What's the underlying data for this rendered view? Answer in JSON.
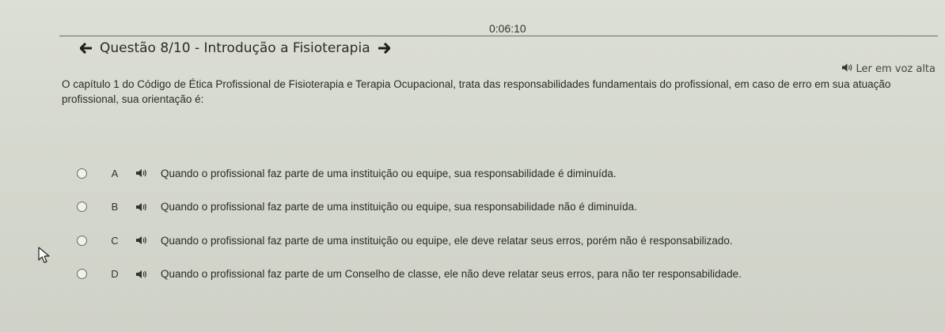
{
  "timer": "0:06:10",
  "header": {
    "title": "Questão 8/10 - Introdução a Fisioterapia",
    "prev_icon": "arrow-left-icon",
    "next_icon": "arrow-right-icon"
  },
  "read_aloud": {
    "label": "Ler em voz alta",
    "icon": "speaker-icon"
  },
  "question": {
    "text": "O capítulo 1 do Código de Ética Profissional de Fisioterapia e Terapia Ocupacional, trata das responsabilidades fundamentais do profissional, em caso de erro em sua atuação profissional, sua orientação é:"
  },
  "options": [
    {
      "letter": "A",
      "text": "Quando o profissional faz parte de uma instituição ou equipe, sua responsabilidade é diminuída."
    },
    {
      "letter": "B",
      "text": "Quando o profissional faz parte de uma instituição ou equipe, sua responsabilidade não é diminuída."
    },
    {
      "letter": "C",
      "text": "Quando o profissional faz parte de uma instituição ou equipe, ele deve relatar seus erros, porém não é responsabilizado."
    },
    {
      "letter": "D",
      "text": "Quando o profissional faz parte de um Conselho de classe, ele não deve relatar seus erros, para não ter responsabilidade."
    }
  ],
  "colors": {
    "background": "#d6d9cf",
    "text": "#2b2b2b",
    "divider": "#6b6b6b"
  }
}
